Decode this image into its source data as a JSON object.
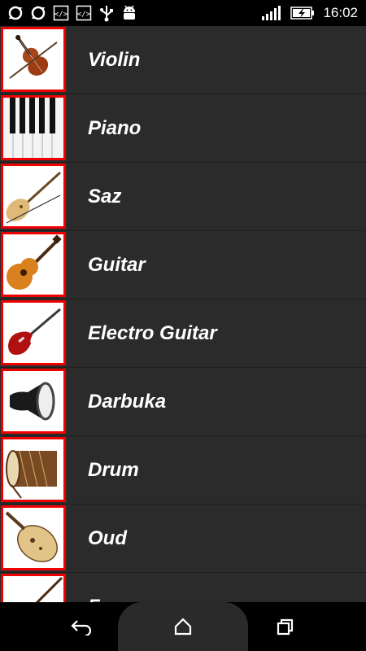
{
  "status_bar": {
    "time": "16:02",
    "icons": [
      "sync-icon",
      "sync-icon",
      "code-icon",
      "code-icon",
      "usb-icon",
      "android-debug-icon",
      "signal-icon",
      "battery-charging-icon"
    ]
  },
  "instruments": [
    {
      "label": "Violin",
      "icon": "violin-icon"
    },
    {
      "label": "Piano",
      "icon": "piano-keys-icon"
    },
    {
      "label": "Saz",
      "icon": "saz-icon"
    },
    {
      "label": "Guitar",
      "icon": "acoustic-guitar-icon"
    },
    {
      "label": "Electro Guitar",
      "icon": "electric-guitar-icon"
    },
    {
      "label": "Darbuka",
      "icon": "darbuka-icon"
    },
    {
      "label": "Drum",
      "icon": "drum-icon"
    },
    {
      "label": "Oud",
      "icon": "oud-icon"
    },
    {
      "label": "F",
      "icon": "flute-icon"
    }
  ],
  "nav": {
    "back": "back-icon",
    "home": "home-icon",
    "recents": "recents-icon"
  },
  "colors": {
    "thumb_border": "#e00000",
    "list_bg": "#2b2b2b",
    "text": "#ffffff"
  }
}
